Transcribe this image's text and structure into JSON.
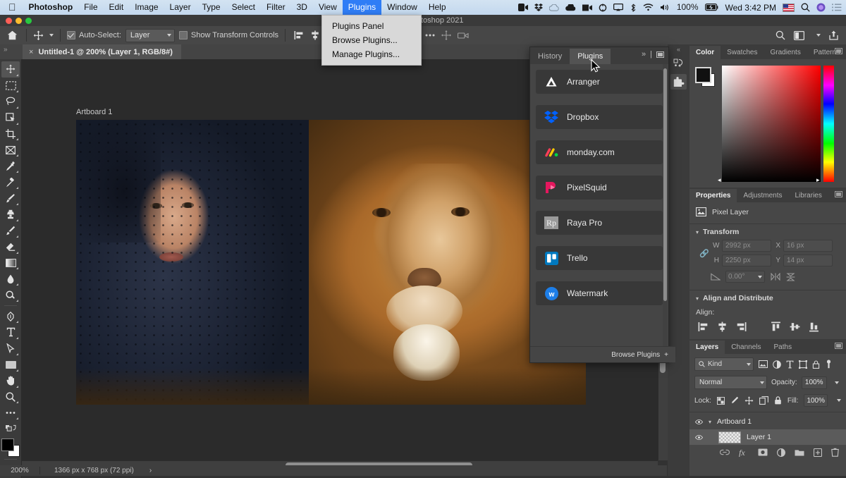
{
  "macos_menubar": {
    "apple_icon": "apple-logo-icon",
    "items": [
      {
        "label": "Photoshop",
        "bold": true,
        "active": false
      },
      {
        "label": "File",
        "bold": false,
        "active": false
      },
      {
        "label": "Edit",
        "bold": false,
        "active": false
      },
      {
        "label": "Image",
        "bold": false,
        "active": false
      },
      {
        "label": "Layer",
        "bold": false,
        "active": false
      },
      {
        "label": "Type",
        "bold": false,
        "active": false
      },
      {
        "label": "Select",
        "bold": false,
        "active": false
      },
      {
        "label": "Filter",
        "bold": false,
        "active": false
      },
      {
        "label": "3D",
        "bold": false,
        "active": false
      },
      {
        "label": "View",
        "bold": false,
        "active": false
      },
      {
        "label": "Plugins",
        "bold": false,
        "active": true
      },
      {
        "label": "Window",
        "bold": false,
        "active": false
      },
      {
        "label": "Help",
        "bold": false,
        "active": false
      }
    ],
    "status_icons": [
      "zoom-meeting-icon",
      "dropbox-icon",
      "creative-cloud-icon",
      "onedrive-cloud-icon",
      "screen-record-icon",
      "sync-icon",
      "airplay-icon",
      "bluetooth-icon",
      "wifi-icon",
      "volume-icon"
    ],
    "battery_percent": "100%",
    "battery_icon": "battery-charging-icon",
    "clock": "Wed 3:42 PM",
    "flag_icon": "us-flag-icon",
    "search_icon": "spotlight-search-icon",
    "siri_icon": "siri-icon",
    "control_center_icon": "control-center-icon"
  },
  "plugins_menu": {
    "items": [
      "Plugins Panel",
      "Browse Plugins...",
      "Manage Plugins..."
    ]
  },
  "window": {
    "title": "Adobe Photoshop 2021",
    "traffic_lights": [
      "close",
      "minimize",
      "zoom"
    ]
  },
  "options_bar": {
    "home_icon": "home-icon",
    "tool_icon": "move-tool-icon",
    "auto_select_label": "Auto-Select:",
    "auto_select_checked": true,
    "auto_select_value": "Layer",
    "show_transform_label": "Show Transform Controls",
    "show_transform_checked": false,
    "align_icons": [
      "align-left-edges-icon",
      "align-horizontal-centers-icon",
      "align-right-edges-icon",
      "distribute-horizontally-icon",
      "align-top-edges-icon",
      "align-vertical-centers-icon",
      "align-bottom-edges-icon"
    ],
    "extra_icons": [
      "three-dots-icon",
      "move-3d-icon",
      "camera-3d-icon"
    ],
    "right_icons": [
      "search-icon",
      "workspace-icon",
      "chevron-down-icon",
      "share-icon"
    ]
  },
  "document_tab": {
    "close_glyph": "×",
    "title": "Untitled-1 @ 200% (Layer 1, RGB/8#)",
    "collapse_glyph": "»"
  },
  "toolbar": {
    "tools": [
      {
        "name": "move-tool",
        "selected": true
      },
      {
        "name": "rectangular-marquee-tool",
        "selected": false
      },
      {
        "name": "lasso-tool",
        "selected": false
      },
      {
        "name": "object-selection-tool",
        "selected": false
      },
      {
        "name": "crop-tool",
        "selected": false
      },
      {
        "name": "frame-tool",
        "selected": false
      },
      {
        "name": "eyedropper-tool",
        "selected": false
      },
      {
        "name": "spot-healing-brush-tool",
        "selected": false
      },
      {
        "name": "brush-tool",
        "selected": false
      },
      {
        "name": "clone-stamp-tool",
        "selected": false
      },
      {
        "name": "history-brush-tool",
        "selected": false
      },
      {
        "name": "eraser-tool",
        "selected": false
      },
      {
        "name": "gradient-tool",
        "selected": false
      },
      {
        "name": "blur-tool",
        "selected": false
      },
      {
        "name": "dodge-tool",
        "selected": false
      },
      {
        "name": "pen-tool",
        "selected": false
      },
      {
        "name": "type-tool",
        "selected": false
      },
      {
        "name": "path-selection-tool",
        "selected": false
      },
      {
        "name": "rectangle-tool",
        "selected": false
      },
      {
        "name": "hand-tool",
        "selected": false
      },
      {
        "name": "zoom-tool",
        "selected": false
      },
      {
        "name": "edit-toolbar-tool",
        "selected": false
      }
    ],
    "foreground_color": "#000000",
    "background_color": "#ffffff",
    "quick_mask_icon": "quick-mask-icon"
  },
  "canvas": {
    "artboard_label": "Artboard 1",
    "image_description": "Composite of a woman wearing a dark blue net veil blended with a lion's face"
  },
  "status_bar": {
    "zoom": "200%",
    "dimensions": "1366 px x 768 px (72 ppi)",
    "expand_glyph": "›"
  },
  "plugins_panel": {
    "tabs": [
      {
        "label": "History",
        "active": false
      },
      {
        "label": "Plugins",
        "active": true
      }
    ],
    "collapse_glyph": "»",
    "menu_icon": "panel-menu-icon",
    "items": [
      {
        "name": "Arranger",
        "icon": "arranger-icon",
        "color": "#ffffff"
      },
      {
        "name": "Dropbox",
        "icon": "dropbox-icon",
        "color": "#0061ff"
      },
      {
        "name": "monday.com",
        "icon": "monday-icon",
        "color": "#ff3d57"
      },
      {
        "name": "PixelSquid",
        "icon": "pixelsquid-icon",
        "color": "#e5175e"
      },
      {
        "name": "Raya Pro",
        "icon": "raya-pro-icon",
        "color": "#b9b9b9"
      },
      {
        "name": "Trello",
        "icon": "trello-icon",
        "color": "#0079bf"
      },
      {
        "name": "Watermark",
        "icon": "watermark-icon",
        "color": "#1d7ee8"
      }
    ],
    "footer_label": "Browse Plugins",
    "footer_plus": "+"
  },
  "dock_strip": {
    "collapse_glyph": "«",
    "buttons": [
      {
        "name": "history-dock-icon",
        "selected": false
      },
      {
        "name": "plugins-dock-icon",
        "selected": true
      }
    ]
  },
  "color_panel": {
    "tabs": [
      {
        "label": "Color",
        "active": true
      },
      {
        "label": "Swatches",
        "active": false
      },
      {
        "label": "Gradients",
        "active": false
      },
      {
        "label": "Patterns",
        "active": false
      }
    ],
    "foreground": "#000000",
    "background": "#ffffff",
    "menu_icon": "panel-menu-icon"
  },
  "properties_panel": {
    "tabs": [
      {
        "label": "Properties",
        "active": true
      },
      {
        "label": "Adjustments",
        "active": false
      },
      {
        "label": "Libraries",
        "active": false
      }
    ],
    "layer_type_icon": "pixel-layer-icon",
    "layer_type_label": "Pixel Layer",
    "transform": {
      "section_label": "Transform",
      "link_icon": "link-icon",
      "w_label": "W",
      "w_value": "2992 px",
      "x_label": "X",
      "x_value": "16 px",
      "h_label": "H",
      "h_value": "2250 px",
      "y_label": "Y",
      "y_value": "14 px",
      "angle_icon": "angle-icon",
      "angle_value": "0.00°",
      "flip_h_icon": "flip-horizontal-icon",
      "flip_v_icon": "flip-vertical-icon"
    },
    "align": {
      "section_label": "Align and Distribute",
      "align_label": "Align:",
      "icons": [
        "align-left-edges-icon",
        "align-horizontal-centers-icon",
        "align-right-edges-icon",
        "align-top-edges-icon",
        "align-vertical-centers-icon",
        "align-bottom-edges-icon"
      ]
    }
  },
  "layers_panel": {
    "tabs": [
      {
        "label": "Layers",
        "active": true
      },
      {
        "label": "Channels",
        "active": false
      },
      {
        "label": "Paths",
        "active": false
      }
    ],
    "filter_label": "Kind",
    "filter_icons": [
      "pixel-filter-icon",
      "adjustment-filter-icon",
      "type-filter-icon",
      "shape-filter-icon",
      "smart-object-filter-icon"
    ],
    "filter_toggle_icon": "filter-toggle-icon",
    "blend_mode": "Normal",
    "opacity_label": "Opacity:",
    "opacity_value": "100%",
    "lock_label": "Lock:",
    "lock_icons": [
      "lock-transparent-pixels-icon",
      "lock-image-pixels-icon",
      "lock-position-icon",
      "lock-artboard-nesting-icon",
      "lock-all-icon"
    ],
    "fill_label": "Fill:",
    "fill_value": "100%",
    "layers": [
      {
        "name": "Artboard 1",
        "type": "artboard",
        "visible": true,
        "selected": false,
        "expanded": true
      },
      {
        "name": "Layer 1",
        "type": "pixel",
        "visible": true,
        "selected": true,
        "expanded": false
      }
    ],
    "bottom_icons": [
      "link-layers-icon",
      "layer-style-icon",
      "layer-mask-icon",
      "adjustment-layer-icon",
      "new-group-icon",
      "new-layer-icon",
      "delete-layer-icon"
    ]
  },
  "cursor": {
    "icon": "arrow-cursor-icon"
  }
}
